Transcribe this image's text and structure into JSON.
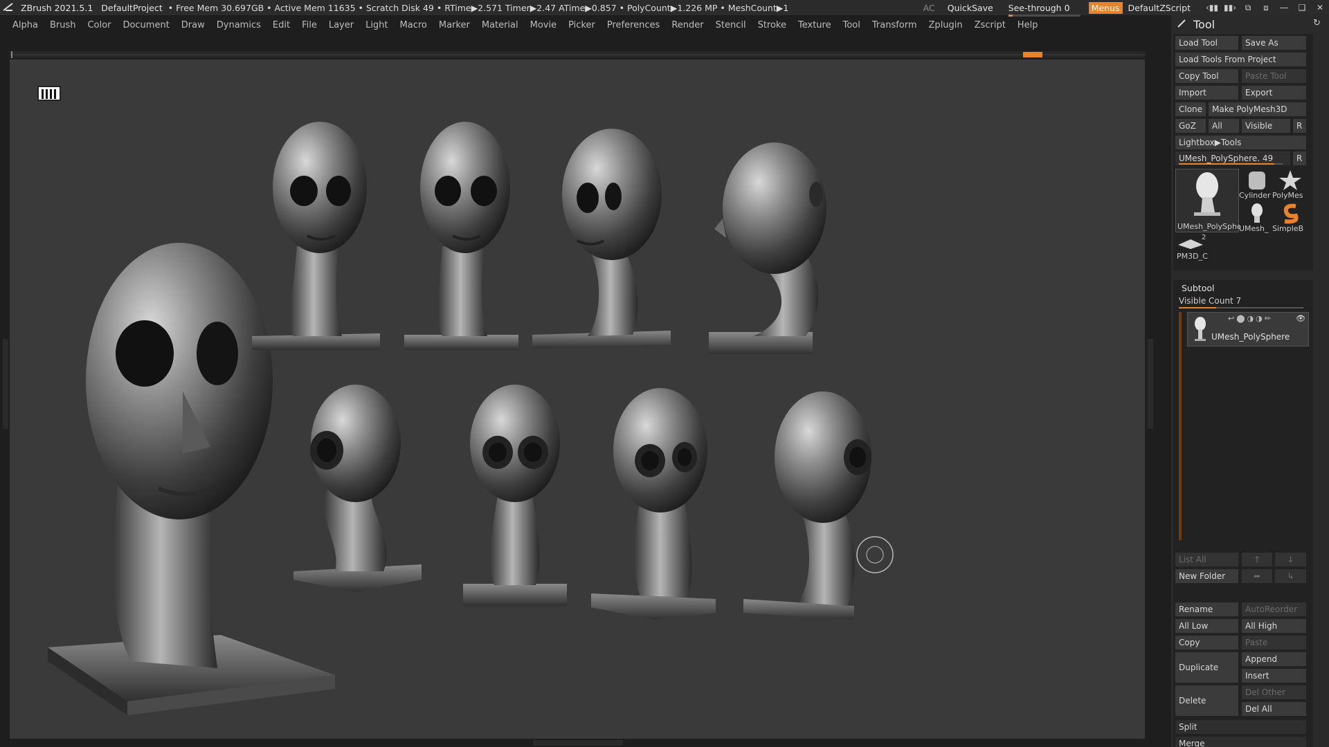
{
  "titlebar": {
    "app_title": "ZBrush 2021.5.1",
    "project": "DefaultProject",
    "stats": "• Free Mem 30.697GB • Active Mem 11635 • Scratch Disk 49 •  RTime▶2.571 Timer▶2.47 ATime▶0.857 • PolyCount▶1.226 MP  • MeshCount▶1",
    "ac": "AC",
    "quicksave": "QuickSave",
    "see_through_label": "See-through  0",
    "see_through_value": 0.06,
    "menus": "Menus",
    "script": "DefaultZScript"
  },
  "menubar": {
    "items": [
      "Alpha",
      "Brush",
      "Color",
      "Document",
      "Draw",
      "Dynamics",
      "Edit",
      "File",
      "Layer",
      "Light",
      "Macro",
      "Marker",
      "Material",
      "Movie",
      "Picker",
      "Preferences",
      "Render",
      "Stencil",
      "Stroke",
      "Texture",
      "Tool",
      "Transform",
      "Zplugin",
      "Zscript",
      "Help"
    ]
  },
  "colors": {
    "accent": "#e8822b",
    "canvas_bg": "#3a3a3a",
    "panel_bg": "#2a2a2a"
  },
  "tool_panel": {
    "title": "Tool",
    "load_tool": "Load Tool",
    "save_as": "Save As",
    "load_from_project": "Load Tools From Project",
    "copy_tool": "Copy Tool",
    "paste_tool": "Paste Tool",
    "import": "Import",
    "export": "Export",
    "clone": "Clone",
    "make_polymesh": "Make PolyMesh3D",
    "goz": "GoZ",
    "all": "All",
    "visible": "Visible",
    "r": "R",
    "lightbox_tools": "Lightbox▶Tools",
    "current_tool": "UMesh_PolySphere. 49",
    "current_tool_slider": 0.92,
    "thumbnails": {
      "main": "UMesh_PolySphe",
      "cylinder": "Cylinder",
      "polymesh": "PolyMes",
      "umesh_small": "UMesh_",
      "simpleb": "SimpleB",
      "pm3d": "PM3D_C",
      "pm3d_count": "2"
    },
    "subtool": {
      "title": "Subtool",
      "visible_count": "Visible Count 7",
      "visible_count_slider": 0.3,
      "item_name": "UMesh_PolySphere",
      "list_all": "List All",
      "new_folder": "New Folder",
      "rename": "Rename",
      "autoreorder": "AutoReorder",
      "all_low": "All Low",
      "all_high": "All High",
      "copy": "Copy",
      "paste": "Paste",
      "duplicate": "Duplicate",
      "append": "Append",
      "insert": "Insert",
      "delete": "Delete",
      "del_other": "Del Other",
      "del_all": "Del All",
      "split": "Split",
      "merge": "Merge"
    }
  }
}
